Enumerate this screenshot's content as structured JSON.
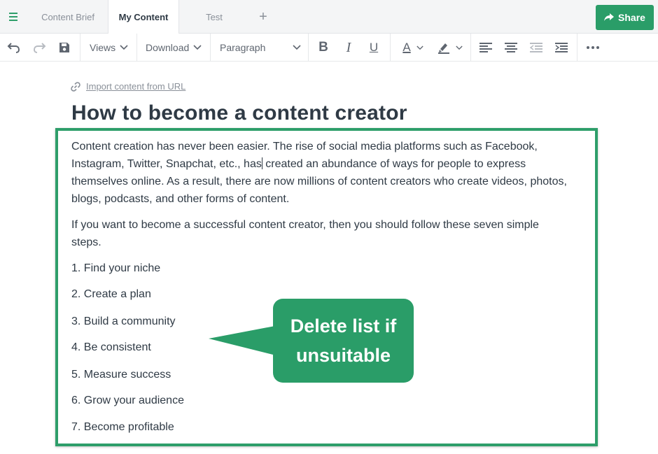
{
  "tabs": {
    "brief": "Content Brief",
    "my_content": "My Content",
    "test": "Test",
    "add": "+"
  },
  "share": {
    "label": "Share"
  },
  "toolbar": {
    "views": "Views",
    "download": "Download",
    "paragraph": "Paragraph",
    "bold": "B",
    "italic": "I",
    "underline": "U",
    "text_color": "A"
  },
  "content": {
    "import_link": "Import content from URL",
    "title": "How to become a content creator",
    "para1_before_caret": "Content creation has never been easier. The rise of social media platforms such as Facebook, Instagram, Twitter, Snapchat, etc., has",
    "para1_after_caret": " created an abundance of ways for people to express themselves online. As a result, there are now millions of content creators who create videos, photos, blogs, podcasts, and other forms of content.",
    "para2": "If you want to become a successful content creator, then you should follow these seven simple steps.",
    "list": [
      "1. Find your niche",
      "2. Create a plan",
      "3. Build a community",
      "4. Be consistent",
      "5. Measure success",
      "6. Grow your audience",
      "7. Become profitable"
    ]
  },
  "callout": {
    "text": "Delete list if unsuitable"
  },
  "colors": {
    "accent": "#2a9d68",
    "text": "#2f3a45",
    "muted": "#8a9099"
  }
}
